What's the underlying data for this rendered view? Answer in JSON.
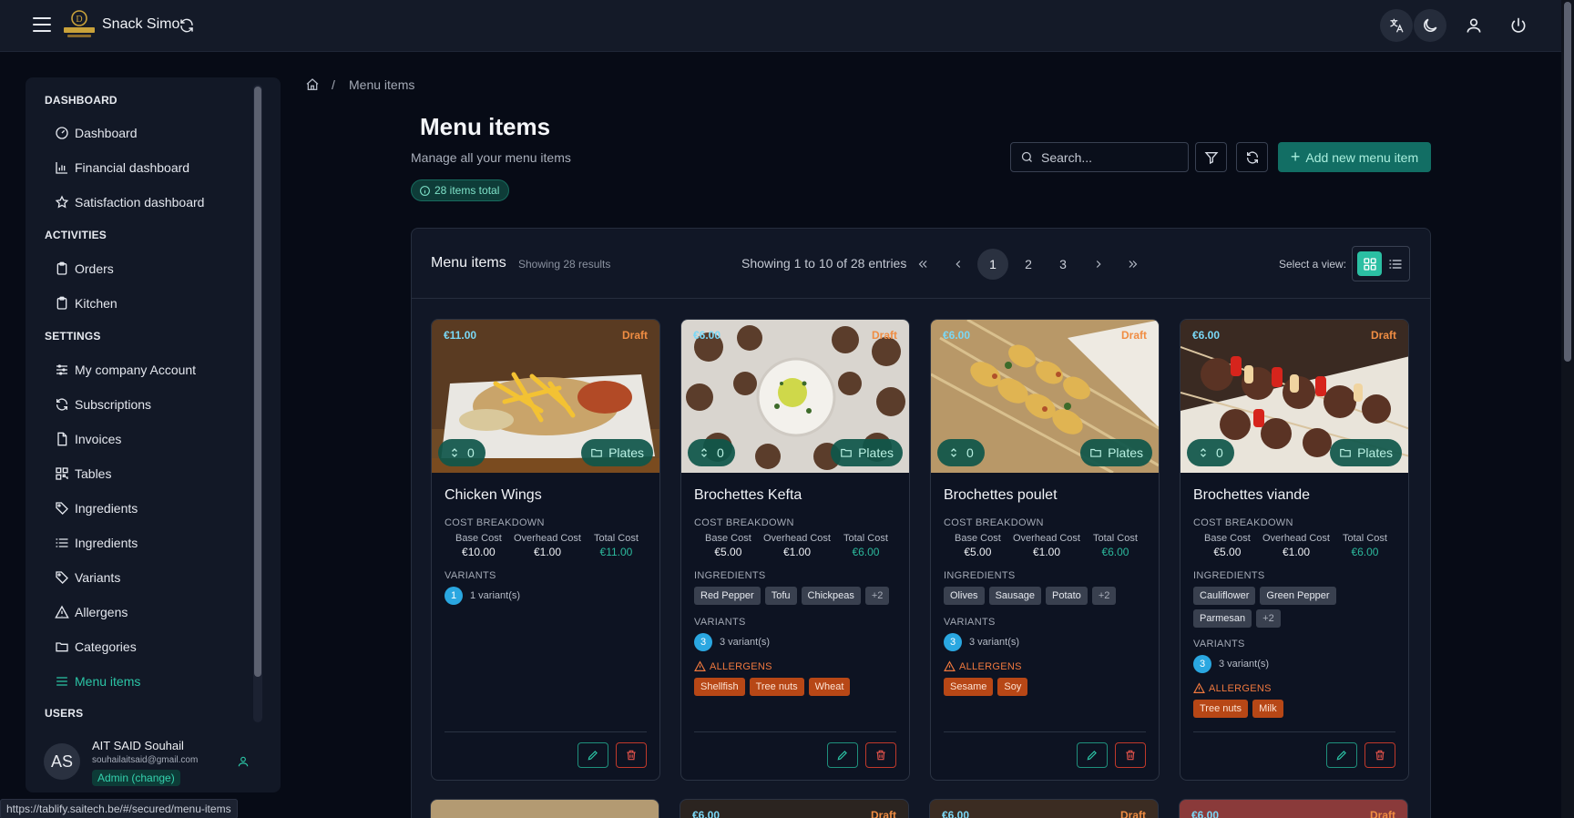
{
  "app": {
    "title": "Snack Simo"
  },
  "sidebar": {
    "sections": [
      {
        "title": "DASHBOARD",
        "items": [
          {
            "label": "Dashboard",
            "icon": "dashboard-icon"
          },
          {
            "label": "Financial dashboard",
            "icon": "bar-chart-icon"
          },
          {
            "label": "Satisfaction dashboard",
            "icon": "star-icon"
          }
        ]
      },
      {
        "title": "ACTIVITIES",
        "items": [
          {
            "label": "Orders",
            "icon": "clipboard-icon"
          },
          {
            "label": "Kitchen",
            "icon": "clipboard-icon"
          }
        ]
      },
      {
        "title": "SETTINGS",
        "items": [
          {
            "label": "My company Account",
            "icon": "sliders-icon"
          },
          {
            "label": "Subscriptions",
            "icon": "refresh-icon"
          },
          {
            "label": "Invoices",
            "icon": "document-icon"
          },
          {
            "label": "Tables",
            "icon": "qr-code-icon"
          },
          {
            "label": "Ingredients",
            "icon": "tag-icon"
          },
          {
            "label": "Ingredients",
            "icon": "list-icon"
          },
          {
            "label": "Variants",
            "icon": "tag-icon"
          },
          {
            "label": "Allergens",
            "icon": "warning-icon"
          },
          {
            "label": "Categories",
            "icon": "folder-icon"
          },
          {
            "label": "Menu items",
            "icon": "menu-icon",
            "active": true
          }
        ]
      },
      {
        "title": "USERS",
        "items": []
      }
    ],
    "user": {
      "initials": "AS",
      "name": "AIT SAID Souhail",
      "email": "souhailaitsaid@gmail.com",
      "role": "Admin (change)"
    }
  },
  "status_url": "https://tablify.saitech.be/#/secured/menu-items",
  "breadcrumb": {
    "sep": "/",
    "current": "Menu items"
  },
  "header": {
    "title": "Menu items",
    "subtitle": "Manage all your menu items",
    "count_badge": "28 items total"
  },
  "toolbar": {
    "search_placeholder": "Search...",
    "add_label": "Add new menu item"
  },
  "panel": {
    "title": "Menu items",
    "subtitle": "Showing 28 results",
    "pager_info": "Showing 1 to 10 of 28 entries",
    "pages": [
      "1",
      "2",
      "3"
    ],
    "active_page": "1",
    "view_label": "Select a view:"
  },
  "labels": {
    "cost_breakdown": "COST BREAKDOWN",
    "base_cost": "Base Cost",
    "overhead_cost": "Overhead Cost",
    "total_cost": "Total Cost",
    "variants": "VARIANTS",
    "ingredients": "INGREDIENTS",
    "allergens": "ALLERGENS"
  },
  "cards": [
    {
      "name": "Chicken Wings",
      "price": "€11.00",
      "status": "Draft",
      "qty": "0",
      "category": "Plates",
      "base": "€10.00",
      "overhead": "€1.00",
      "total": "€11.00",
      "ingredients": [],
      "ingredients_more": "",
      "variant_count": "1",
      "variant_text": "1 variant(s)",
      "allergens": []
    },
    {
      "name": "Brochettes Kefta",
      "price": "€6.00",
      "status": "Draft",
      "qty": "0",
      "category": "Plates",
      "base": "€5.00",
      "overhead": "€1.00",
      "total": "€6.00",
      "ingredients": [
        "Red Pepper",
        "Tofu",
        "Chickpeas"
      ],
      "ingredients_more": "+2",
      "variant_count": "3",
      "variant_text": "3 variant(s)",
      "allergens": [
        "Shellfish",
        "Tree nuts",
        "Wheat"
      ]
    },
    {
      "name": "Brochettes poulet",
      "price": "€6.00",
      "status": "Draft",
      "qty": "0",
      "category": "Plates",
      "base": "€5.00",
      "overhead": "€1.00",
      "total": "€6.00",
      "ingredients": [
        "Olives",
        "Sausage",
        "Potato"
      ],
      "ingredients_more": "+2",
      "variant_count": "3",
      "variant_text": "3 variant(s)",
      "allergens": [
        "Sesame",
        "Soy"
      ]
    },
    {
      "name": "Brochettes viande",
      "price": "€6.00",
      "status": "Draft",
      "qty": "0",
      "category": "Plates",
      "base": "€5.00",
      "overhead": "€1.00",
      "total": "€6.00",
      "ingredients": [
        "Cauliflower",
        "Green Pepper",
        "Parmesan"
      ],
      "ingredients_more": "+2",
      "variant_count": "3",
      "variant_text": "3 variant(s)",
      "allergens": [
        "Tree nuts",
        "Milk"
      ]
    }
  ],
  "peek_cards": [
    {
      "price": "",
      "status": ""
    },
    {
      "price": "€6.00",
      "status": "Draft"
    },
    {
      "price": "€6.00",
      "status": "Draft"
    },
    {
      "price": "€6.00",
      "status": "Draft"
    }
  ],
  "colors": {
    "accent": "#2bc4a5",
    "draft": "#f08d43",
    "price": "#7ad8f6",
    "allergen": "#b74716"
  }
}
